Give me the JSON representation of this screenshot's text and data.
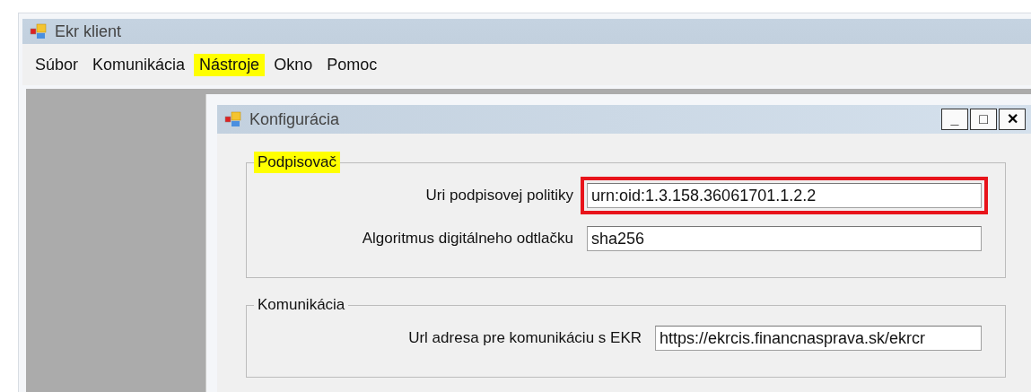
{
  "window": {
    "title": "Ekr klient"
  },
  "menu": [
    {
      "label": "Súbor",
      "highlighted": false
    },
    {
      "label": "Komunikácia",
      "highlighted": false
    },
    {
      "label": "Nástroje",
      "highlighted": true
    },
    {
      "label": "Okno",
      "highlighted": false
    },
    {
      "label": "Pomoc",
      "highlighted": false
    }
  ],
  "dialog": {
    "title": "Konfigurácia",
    "controls": [
      "_",
      "□",
      "✕"
    ],
    "groups": [
      {
        "title": "Podpisovač",
        "highlighted": true,
        "fields": [
          {
            "label": "Uri podpisovej politiky",
            "value": "urn:oid:1.3.158.36061701.1.2.2",
            "outlined": true
          },
          {
            "label": "Algoritmus digitálneho odtlačku",
            "value": "sha256",
            "outlined": false
          }
        ]
      },
      {
        "title": "Komunikácia",
        "highlighted": false,
        "fields": [
          {
            "label": "Url adresa pre komunikáciu s EKR",
            "value": "https://ekrcis.financnasprava.sk/ekrcr",
            "outlined": false
          }
        ]
      }
    ]
  }
}
